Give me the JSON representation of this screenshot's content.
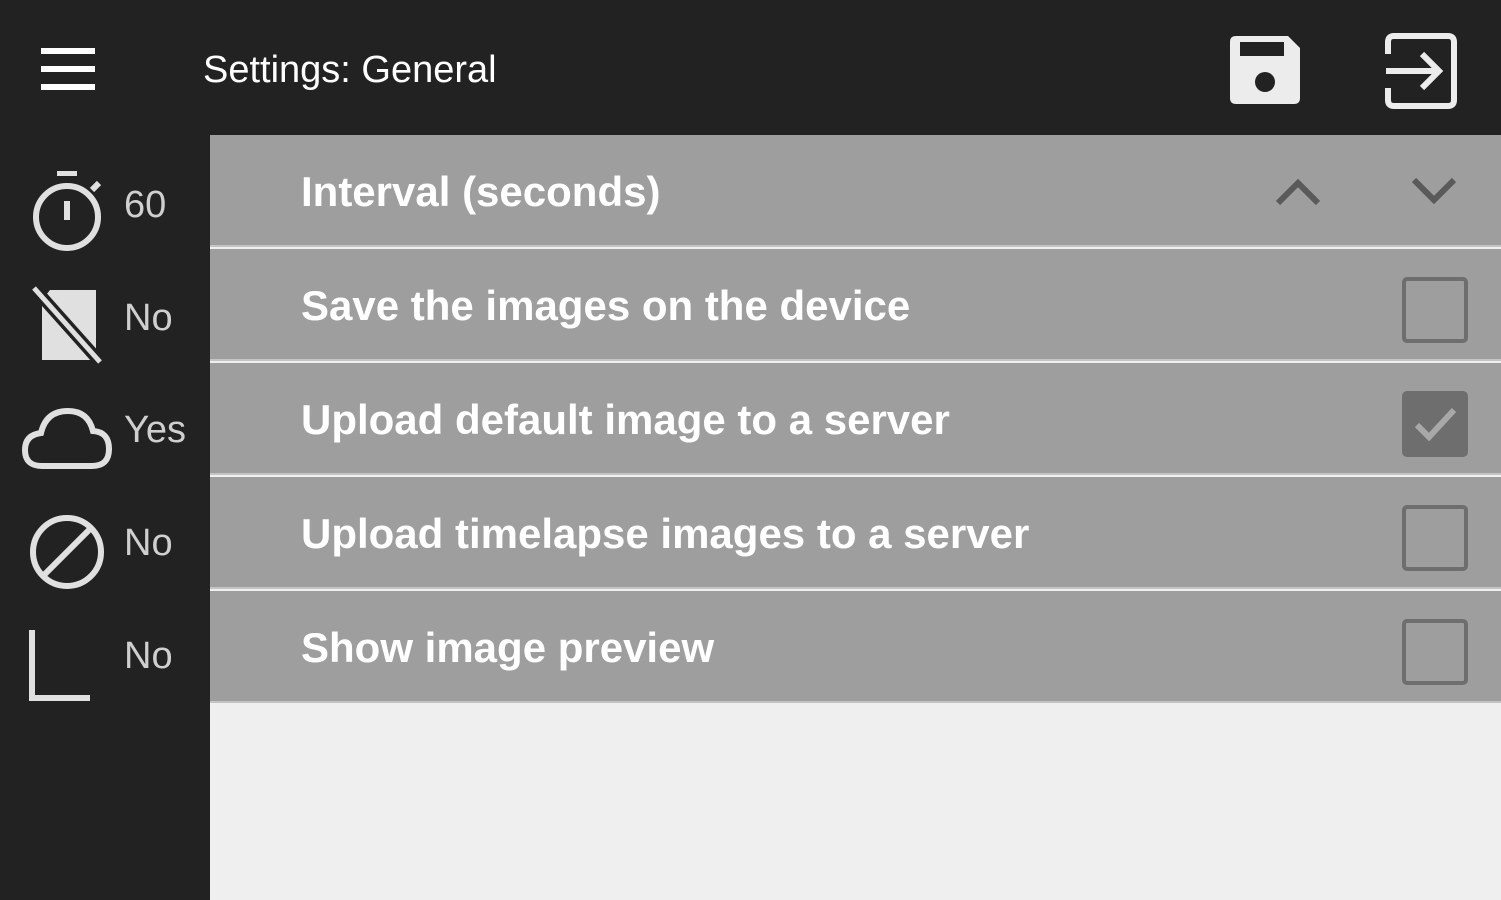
{
  "header": {
    "title": "Settings: General",
    "menu_icon": "hamburger-menu-icon",
    "save_icon": "floppy-save-icon",
    "exit_icon": "exit-to-app-icon"
  },
  "sidebar": {
    "items": [
      {
        "icon": "stopwatch-icon",
        "value": "60"
      },
      {
        "icon": "sd-card-off-icon",
        "value": "No"
      },
      {
        "icon": "cloud-icon",
        "value": "Yes"
      },
      {
        "icon": "block-icon",
        "value": "No"
      },
      {
        "icon": "corner-icon",
        "value": "No"
      }
    ]
  },
  "settings": {
    "interval": {
      "label": "Interval (seconds)"
    },
    "rows": [
      {
        "label": "Save the images on the device",
        "checked": false
      },
      {
        "label": "Upload default image to a server",
        "checked": true
      },
      {
        "label": "Upload timelapse images to a server",
        "checked": false
      },
      {
        "label": "Show image preview",
        "checked": false
      }
    ]
  },
  "colors": {
    "bar_background": "#222222",
    "row_background": "#9e9e9e",
    "checkbox": "#6e6e6e",
    "page_background": "#efefef"
  }
}
